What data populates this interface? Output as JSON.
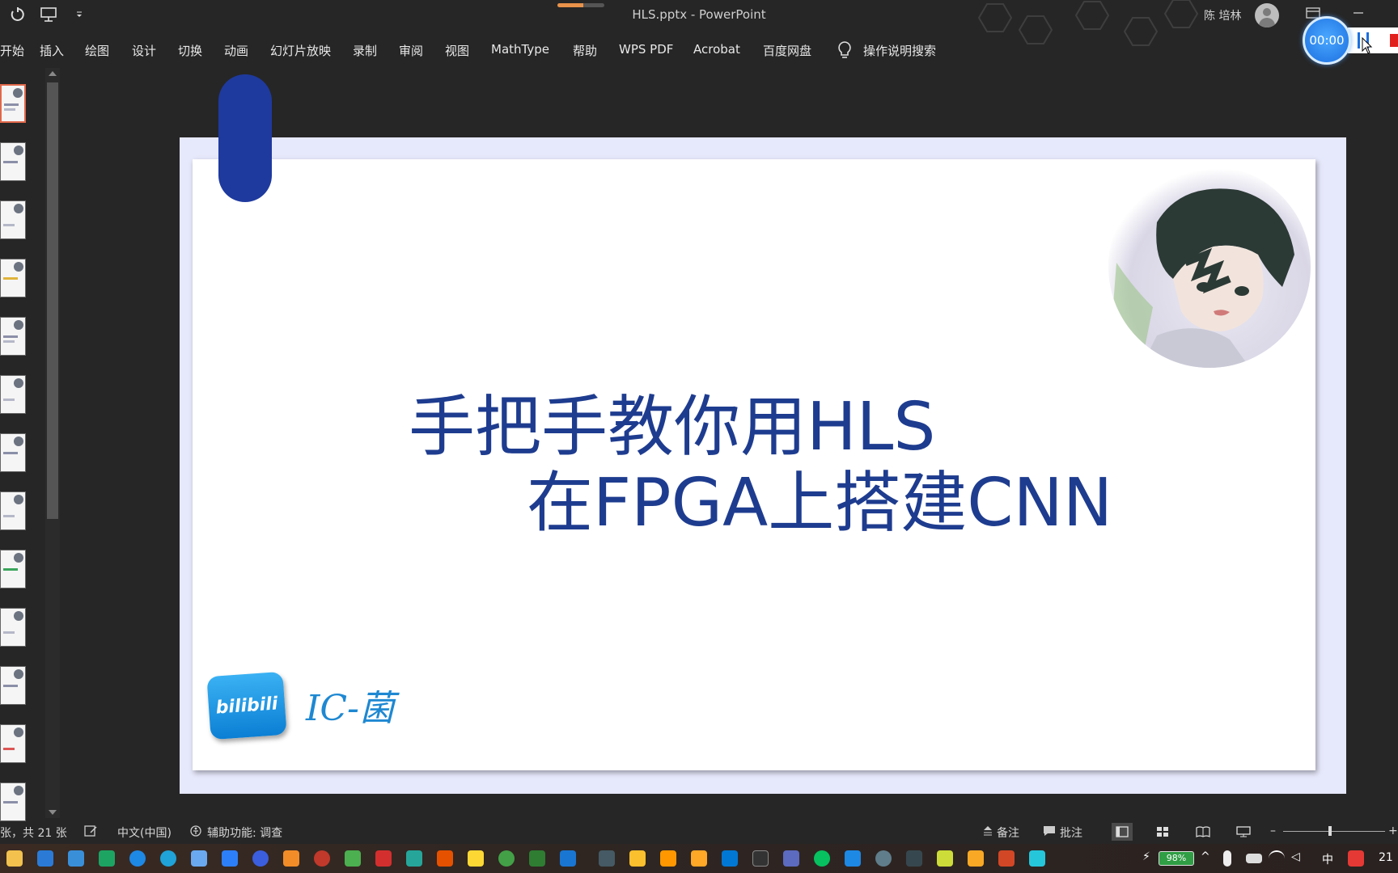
{
  "window": {
    "title": "HLS.pptx  -  PowerPoint",
    "user_name": "陈 培林",
    "title_progress": 0.55
  },
  "ribbon": {
    "tabs": [
      "开始",
      "插入",
      "绘图",
      "设计",
      "切换",
      "动画",
      "幻灯片放映",
      "录制",
      "审阅",
      "视图",
      "MathType",
      "帮助",
      "WPS PDF",
      "Acrobat",
      "百度网盘"
    ],
    "tell_me": "操作说明搜索"
  },
  "recorder": {
    "timer": "00:00"
  },
  "slide": {
    "title_line1": "手把手教你用HLS",
    "title_line2": "在FPGA上搭建CNN",
    "logo_text": "bilibili",
    "signature": "IC-菌",
    "accent_color": "#1e3a9e",
    "title_color": "#1e3c8f"
  },
  "statusbar": {
    "slide_count": "张，共 21 张",
    "language": "中文(中国)",
    "accessibility": "辅助功能: 调查",
    "notes": "备注",
    "comments": "批注"
  },
  "taskbar": {
    "battery": "98%",
    "ime": "中",
    "clock": "21"
  }
}
